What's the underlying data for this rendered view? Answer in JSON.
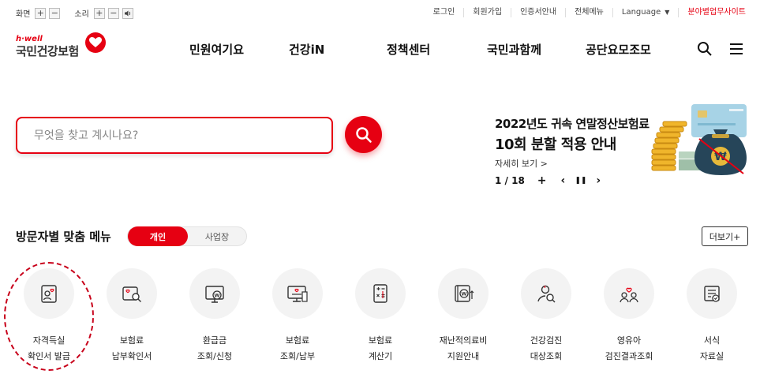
{
  "util_bar": {
    "screen_label": "화면",
    "screen_plus": "+",
    "screen_minus": "−",
    "sound_label": "소리",
    "sound_plus": "+",
    "sound_minus": "−",
    "links": [
      "로그인",
      "회원가입",
      "인증서안내",
      "전체메뉴"
    ],
    "language_label": "Language",
    "site_link": "분야별업무사이트"
  },
  "logo": {
    "top": "h·well",
    "main": "국민건강보험"
  },
  "gnb": [
    "민원여기요",
    "건강iN",
    "정책센터",
    "국민과함께",
    "공단요모조모"
  ],
  "search": {
    "placeholder": "무엇을 찾고 계시나요?"
  },
  "banner": {
    "title_line1": "2022년도 귀속 연말정산보험료",
    "title_line2": "10회 분할 적용 안내",
    "more": "자세히 보기 >",
    "page": "1 / 18",
    "add": "+",
    "prev": "‹",
    "pause": "❚❚",
    "next": "›"
  },
  "tailored_menu": {
    "title": "방문자별 맞춤 메뉴",
    "tab_active": "개인",
    "tab_inactive": "사업장",
    "more_button": "더보기+",
    "items": [
      {
        "line1": "자격득실",
        "line2": "확인서 발급",
        "icon": "id-card-heart-icon"
      },
      {
        "line1": "보험료",
        "line2": "납부확인서",
        "icon": "document-search-icon"
      },
      {
        "line1": "환급금",
        "line2": "조회/신청",
        "icon": "monitor-won-icon"
      },
      {
        "line1": "보험료",
        "line2": "조회/납부",
        "icon": "receipt-monitor-icon"
      },
      {
        "line1": "보험료",
        "line2": "계산기",
        "icon": "calculator-icon"
      },
      {
        "line1": "재난적의료비",
        "line2": "지원안내",
        "icon": "won-support-icon"
      },
      {
        "line1": "건강검진",
        "line2": "대상조회",
        "icon": "people-search-icon"
      },
      {
        "line1": "영유아",
        "line2": "검진결과조회",
        "icon": "family-heart-icon"
      },
      {
        "line1": "서식",
        "line2": "자료실",
        "icon": "form-check-icon"
      }
    ]
  },
  "colors": {
    "brand_red": "#e60012",
    "text_dark": "#111111",
    "circle_bg": "#f3f3f3"
  }
}
